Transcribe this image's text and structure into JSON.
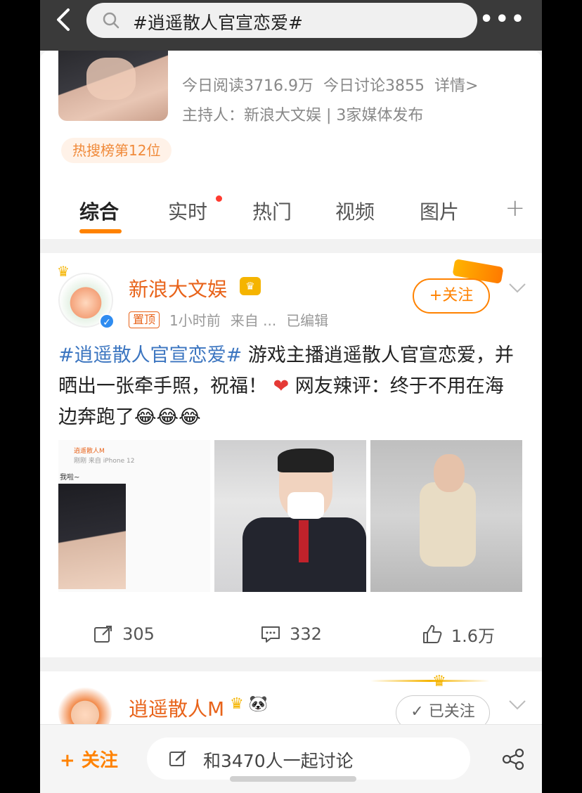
{
  "search": {
    "query": "#逍遥散人官宣恋爱#"
  },
  "topic": {
    "stats_read": "今日阅读3716.9万",
    "stats_discuss": "今日讨论3855",
    "details_link": "详情>",
    "host": "主持人：新浪大文娱 | 3家媒体发布",
    "hot_rank": "热搜榜第12位"
  },
  "tabs": [
    {
      "label": "综合",
      "active": true
    },
    {
      "label": "实时",
      "active": false,
      "has_dot": true
    },
    {
      "label": "热门",
      "active": false
    },
    {
      "label": "视频",
      "active": false
    },
    {
      "label": "图片",
      "active": false
    }
  ],
  "post1": {
    "author": "新浪大文娱",
    "pinned_label": "置顶",
    "time": "1小时前",
    "source": "来自 ...",
    "edited": "已编辑",
    "follow_label": "+关注",
    "topic_tag": "#逍遥散人官宣恋爱#",
    "text_body": " 游戏主播逍遥散人官宣恋爱，并晒出一张牵手照，祝福！",
    "text_after_heart": " 网友辣评：终于不用在海边奔跑了😂😂😂",
    "heart_icon": "heart-icon",
    "image1_caption": "逍遥散人M",
    "image1_sub": "刚刚 来自 iPhone 12",
    "image1_line": "我啦~",
    "repost_count": "305",
    "comment_count": "332",
    "like_count": "1.6万"
  },
  "post2": {
    "author": "逍遥散人M",
    "followed_label": "已关注"
  },
  "bottom": {
    "follow_label": "+ 关注",
    "discuss_placeholder": "和3470人一起讨论"
  },
  "colors": {
    "accent": "#ff8200",
    "author": "#e8631a",
    "link": "#3b75c0"
  }
}
